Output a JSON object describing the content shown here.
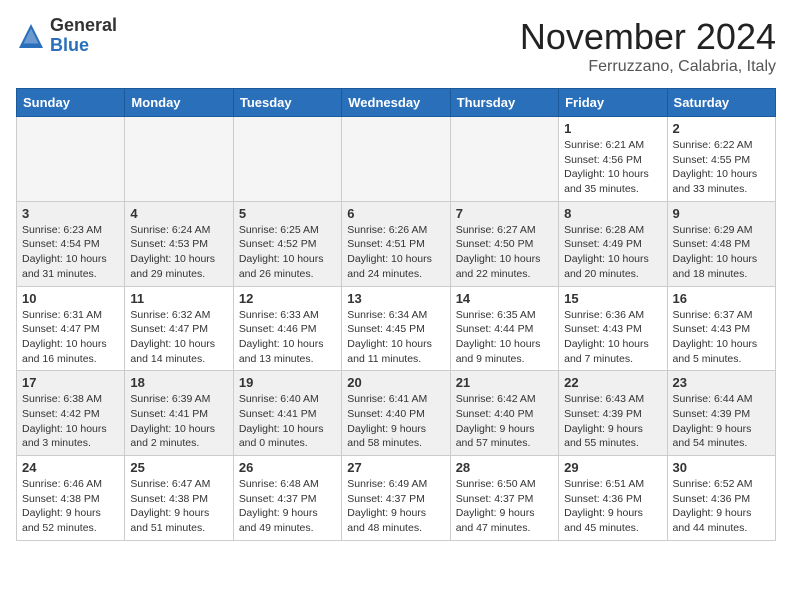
{
  "header": {
    "logo_general": "General",
    "logo_blue": "Blue",
    "month": "November 2024",
    "location": "Ferruzzano, Calabria, Italy"
  },
  "weekdays": [
    "Sunday",
    "Monday",
    "Tuesday",
    "Wednesday",
    "Thursday",
    "Friday",
    "Saturday"
  ],
  "weeks": [
    {
      "shaded": false,
      "days": [
        {
          "num": "",
          "info": ""
        },
        {
          "num": "",
          "info": ""
        },
        {
          "num": "",
          "info": ""
        },
        {
          "num": "",
          "info": ""
        },
        {
          "num": "",
          "info": ""
        },
        {
          "num": "1",
          "info": "Sunrise: 6:21 AM\nSunset: 4:56 PM\nDaylight: 10 hours and 35 minutes."
        },
        {
          "num": "2",
          "info": "Sunrise: 6:22 AM\nSunset: 4:55 PM\nDaylight: 10 hours and 33 minutes."
        }
      ]
    },
    {
      "shaded": true,
      "days": [
        {
          "num": "3",
          "info": "Sunrise: 6:23 AM\nSunset: 4:54 PM\nDaylight: 10 hours and 31 minutes."
        },
        {
          "num": "4",
          "info": "Sunrise: 6:24 AM\nSunset: 4:53 PM\nDaylight: 10 hours and 29 minutes."
        },
        {
          "num": "5",
          "info": "Sunrise: 6:25 AM\nSunset: 4:52 PM\nDaylight: 10 hours and 26 minutes."
        },
        {
          "num": "6",
          "info": "Sunrise: 6:26 AM\nSunset: 4:51 PM\nDaylight: 10 hours and 24 minutes."
        },
        {
          "num": "7",
          "info": "Sunrise: 6:27 AM\nSunset: 4:50 PM\nDaylight: 10 hours and 22 minutes."
        },
        {
          "num": "8",
          "info": "Sunrise: 6:28 AM\nSunset: 4:49 PM\nDaylight: 10 hours and 20 minutes."
        },
        {
          "num": "9",
          "info": "Sunrise: 6:29 AM\nSunset: 4:48 PM\nDaylight: 10 hours and 18 minutes."
        }
      ]
    },
    {
      "shaded": false,
      "days": [
        {
          "num": "10",
          "info": "Sunrise: 6:31 AM\nSunset: 4:47 PM\nDaylight: 10 hours and 16 minutes."
        },
        {
          "num": "11",
          "info": "Sunrise: 6:32 AM\nSunset: 4:47 PM\nDaylight: 10 hours and 14 minutes."
        },
        {
          "num": "12",
          "info": "Sunrise: 6:33 AM\nSunset: 4:46 PM\nDaylight: 10 hours and 13 minutes."
        },
        {
          "num": "13",
          "info": "Sunrise: 6:34 AM\nSunset: 4:45 PM\nDaylight: 10 hours and 11 minutes."
        },
        {
          "num": "14",
          "info": "Sunrise: 6:35 AM\nSunset: 4:44 PM\nDaylight: 10 hours and 9 minutes."
        },
        {
          "num": "15",
          "info": "Sunrise: 6:36 AM\nSunset: 4:43 PM\nDaylight: 10 hours and 7 minutes."
        },
        {
          "num": "16",
          "info": "Sunrise: 6:37 AM\nSunset: 4:43 PM\nDaylight: 10 hours and 5 minutes."
        }
      ]
    },
    {
      "shaded": true,
      "days": [
        {
          "num": "17",
          "info": "Sunrise: 6:38 AM\nSunset: 4:42 PM\nDaylight: 10 hours and 3 minutes."
        },
        {
          "num": "18",
          "info": "Sunrise: 6:39 AM\nSunset: 4:41 PM\nDaylight: 10 hours and 2 minutes."
        },
        {
          "num": "19",
          "info": "Sunrise: 6:40 AM\nSunset: 4:41 PM\nDaylight: 10 hours and 0 minutes."
        },
        {
          "num": "20",
          "info": "Sunrise: 6:41 AM\nSunset: 4:40 PM\nDaylight: 9 hours and 58 minutes."
        },
        {
          "num": "21",
          "info": "Sunrise: 6:42 AM\nSunset: 4:40 PM\nDaylight: 9 hours and 57 minutes."
        },
        {
          "num": "22",
          "info": "Sunrise: 6:43 AM\nSunset: 4:39 PM\nDaylight: 9 hours and 55 minutes."
        },
        {
          "num": "23",
          "info": "Sunrise: 6:44 AM\nSunset: 4:39 PM\nDaylight: 9 hours and 54 minutes."
        }
      ]
    },
    {
      "shaded": false,
      "days": [
        {
          "num": "24",
          "info": "Sunrise: 6:46 AM\nSunset: 4:38 PM\nDaylight: 9 hours and 52 minutes."
        },
        {
          "num": "25",
          "info": "Sunrise: 6:47 AM\nSunset: 4:38 PM\nDaylight: 9 hours and 51 minutes."
        },
        {
          "num": "26",
          "info": "Sunrise: 6:48 AM\nSunset: 4:37 PM\nDaylight: 9 hours and 49 minutes."
        },
        {
          "num": "27",
          "info": "Sunrise: 6:49 AM\nSunset: 4:37 PM\nDaylight: 9 hours and 48 minutes."
        },
        {
          "num": "28",
          "info": "Sunrise: 6:50 AM\nSunset: 4:37 PM\nDaylight: 9 hours and 47 minutes."
        },
        {
          "num": "29",
          "info": "Sunrise: 6:51 AM\nSunset: 4:36 PM\nDaylight: 9 hours and 45 minutes."
        },
        {
          "num": "30",
          "info": "Sunrise: 6:52 AM\nSunset: 4:36 PM\nDaylight: 9 hours and 44 minutes."
        }
      ]
    }
  ]
}
